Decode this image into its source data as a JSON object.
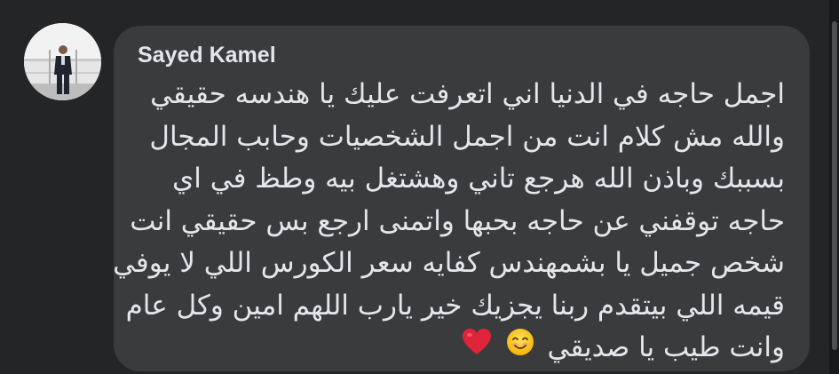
{
  "comment": {
    "author": "Sayed Kamel",
    "avatar_icon": "profile-photo",
    "lines": [
      "اجمل حاجه في الدنيا اني اتعرفت عليك يا هندسه حقيقي",
      "والله مش كلام انت من اجمل الشخصيات وحابب المجال",
      "بسببك وباذن الله هرجع تاني وهشتغل بيه وطظ في اي",
      "حاجه توقفني عن حاجه بحبها واتمنى ارجع بس حقيقي انت",
      "شخص جميل يا بشمهندس كفايه سعر الكورس اللي لا يوفي",
      "قيمه اللي بيتقدم ربنا يجزيك خير يارب اللهم امين وكل عام",
      "وانت طيب يا صديقي"
    ],
    "emojis": [
      "smiling-face-icon",
      "red-heart-icon"
    ]
  },
  "colors": {
    "background": "#242526",
    "bubble": "#3a3b3c",
    "text": "#e4e6eb",
    "heart": "#e0243a",
    "smile": "#ffcc22"
  }
}
